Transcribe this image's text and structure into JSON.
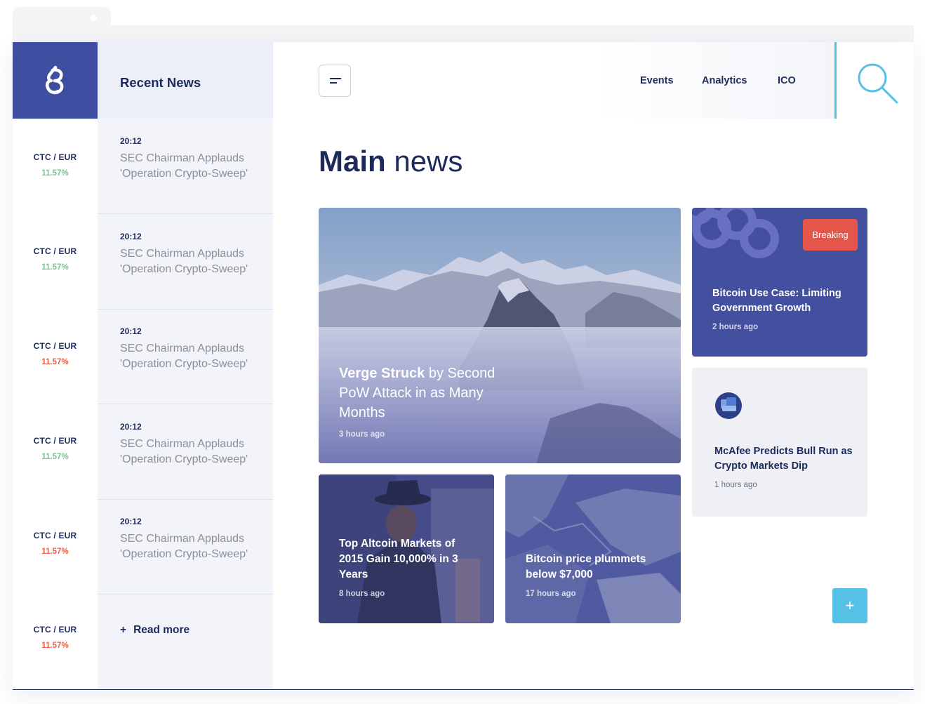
{
  "sidebar": {
    "logo_icon": "brand-logo-icon",
    "tickers": [
      {
        "pair": "CTC / EUR",
        "change": "11.57%",
        "trend": "up"
      },
      {
        "pair": "CTC / EUR",
        "change": "11.57%",
        "trend": "up"
      },
      {
        "pair": "CTC / EUR",
        "change": "11.57%",
        "trend": "down"
      },
      {
        "pair": "CTC / EUR",
        "change": "11.57%",
        "trend": "up"
      },
      {
        "pair": "CTC / EUR",
        "change": "11.57%",
        "trend": "down"
      },
      {
        "pair": "CTC / EUR",
        "change": "11.57%",
        "trend": "down"
      }
    ]
  },
  "recent": {
    "title": "Recent News",
    "items": [
      {
        "time": "20:12",
        "text": "SEC Chairman Applauds 'Operation Crypto-Sweep'"
      },
      {
        "time": "20:12",
        "text": "SEC Chairman Applauds 'Operation Crypto-Sweep'"
      },
      {
        "time": "20:12",
        "text": "SEC Chairman Applauds 'Operation Crypto-Sweep'"
      },
      {
        "time": "20:12",
        "text": "SEC Chairman Applauds 'Operation Crypto-Sweep'"
      },
      {
        "time": "20:12",
        "text": "SEC Chairman Applauds 'Operation Crypto-Sweep'"
      }
    ],
    "read_more_icon": "+",
    "read_more": "Read more"
  },
  "nav": {
    "menu_icon": "hamburger-menu-icon",
    "links": [
      "Events",
      "Analytics",
      "ICO"
    ],
    "search_icon": "search-icon"
  },
  "main": {
    "title_bold": "Main",
    "title_rest": " news",
    "featured": {
      "title_bold": "Verge Struck",
      "title_rest": " by Second PoW Attack in as Many Months",
      "time": "3 hours ago"
    },
    "card_left": {
      "title": "Top Altcoin Markets of 2015 Gain 10,000% in 3 Years",
      "time": "8 hours ago"
    },
    "card_right": {
      "title": "Bitcoin price plummets below $7,000",
      "time": "17 hours ago"
    },
    "breaking": {
      "badge": "Breaking",
      "title": "Bitcoin Use Case: Limiting Government Growth",
      "time": "2 hours ago"
    },
    "mcafee": {
      "title": "McAfee Predicts Bull Run as Crypto Markets Dip",
      "time": "1 hours ago",
      "icon": "mcafee-avatar-icon"
    },
    "add_label": "+"
  },
  "colors": {
    "primary": "#3f4ea0",
    "accent": "#56c1e6",
    "breaking": "#e4564a",
    "up": "#7cc28d",
    "down": "#ea6048",
    "text": "#1d2a5c"
  }
}
